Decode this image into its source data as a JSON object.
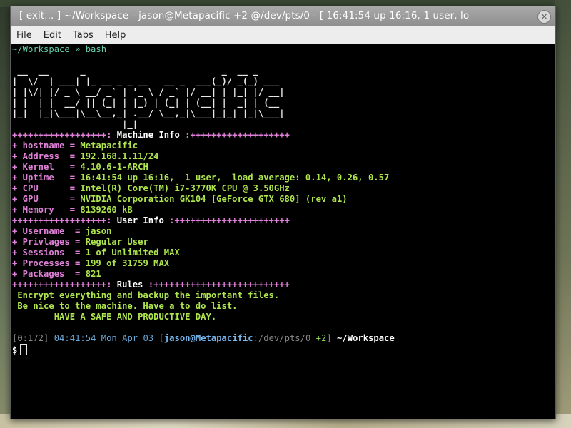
{
  "window": {
    "title": "[ exit... ] ~/Workspace - jason@Metapacific +2 @/dev/pts/0 - [  16:41:54 up 16:16,  1 user,  lo",
    "close_glyph": "×"
  },
  "menu": [
    "File",
    "Edit",
    "Tabs",
    "Help"
  ],
  "terminal": {
    "first_prompt": "~/Workspace » bash",
    "ascii_logo": [
      " __  __      _                          _  __ _      ",
      "|  \\/  | ___| |_ __ _ _ __   __ _  ___(_)/ _(_) ___ ",
      "| |\\/| |/ _ \\ __/ _` | '_ \\ / _` |/ __| | |_| |/ __|",
      "| |  | |  __/ || (_| | |_) | (_| | (__| |  _| | (__ ",
      "|_|  |_|\\___|\\__\\__,_| .__/ \\__,_|\\___|_|_| |_|\\___|",
      "                     |_|                              "
    ],
    "machine_header": {
      "left": "++++++++++++++++++: ",
      "title": "Machine Info",
      "right": " :+++++++++++++++++++"
    },
    "machine_info": [
      {
        "label": "+ hostname = ",
        "value": "Metapacific"
      },
      {
        "label": "+ Address  = ",
        "value": "192.168.1.11/24"
      },
      {
        "label": "+ Kernel   = ",
        "value": "4.10.6-1-ARCH"
      },
      {
        "label": "+ Uptime   = ",
        "value": "16:41:54 up 16:16,  1 user,  load average: 0.14, 0.26, 0.57"
      },
      {
        "label": "+ CPU      = ",
        "value": "Intel(R) Core(TM) i7-3770K CPU @ 3.50GHz"
      },
      {
        "label": "+ GPU      = ",
        "value": "NVIDIA Corporation GK104 [GeForce GTX 680] (rev a1)"
      },
      {
        "label": "+ Memory   = ",
        "value": "8139260 kB"
      }
    ],
    "user_header": {
      "left": "++++++++++++++++++: ",
      "title": "User Info",
      "right": " :++++++++++++++++++++++"
    },
    "user_info": [
      {
        "label": "+ Username  = ",
        "value": "jason"
      },
      {
        "label": "+ Privlages = ",
        "value": "Regular User"
      },
      {
        "label": "+ Sessions  = ",
        "value": "1 of Unlimited MAX"
      },
      {
        "label": "+ Processes = ",
        "value": "199 of 31759 MAX"
      },
      {
        "label": "+ Packages  = ",
        "value": "821"
      }
    ],
    "rules_header": {
      "left": "++++++++++++++++++: ",
      "title": "Rules",
      "right": " :++++++++++++++++++++++++++"
    },
    "rules": [
      " Encrypt everything and backup the important files.",
      " Be nice to the machine. Have a to do list.",
      "        HAVE A SAFE AND PRODUCTIVE DAY."
    ],
    "status_line": {
      "session": "[0:172]",
      "time": "04:41:54 Mon Apr 03",
      "open_bracket": "[",
      "userhost": "jason@Metapacific",
      "tty": ":/dev/pts/0",
      "plus": "+2",
      "close_bracket": "]",
      "cwd": "~/Workspace"
    },
    "prompt_symbol": "$"
  },
  "colors": {
    "title_bar": "#9a9a9a",
    "menu_bar": "#ededed",
    "terminal_bg": "#000000",
    "plus_pink": "#e080d8",
    "value_green": "#aee54e",
    "path_teal": "#66cdaa",
    "user_blue": "#79b6ec"
  }
}
